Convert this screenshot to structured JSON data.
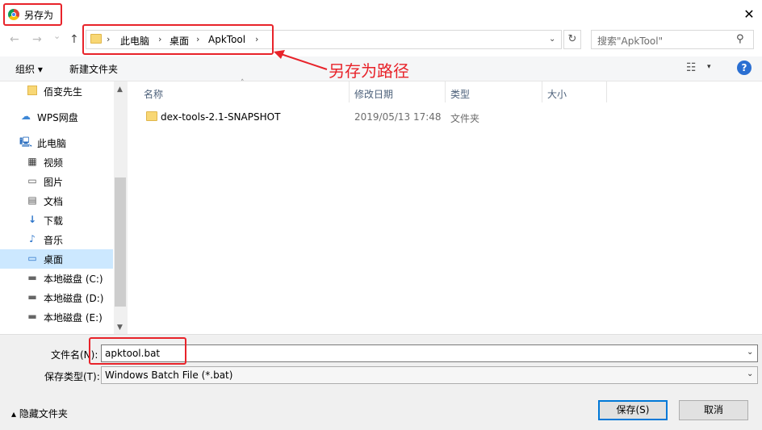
{
  "window": {
    "title": "另存为",
    "close_glyph": "✕"
  },
  "nav": {
    "back_glyph": "←",
    "forward_glyph": "→",
    "recent_glyph": "⌄",
    "up_glyph": "↑",
    "breadcrumb": [
      {
        "label": "此电脑"
      },
      {
        "label": "桌面"
      },
      {
        "label": "ApkTool"
      }
    ],
    "sep_glyph": "›",
    "dropdown_glyph": "⌄",
    "refresh_glyph": "↻",
    "search_placeholder": "搜索\"ApkTool\"",
    "search_glyph": "⚲"
  },
  "toolbar": {
    "organize_label": "组织 ▾",
    "new_folder_label": "新建文件夹",
    "view_glyph": "☷",
    "view_dd_glyph": "▾",
    "help_glyph": "?"
  },
  "sidebar": {
    "items": [
      {
        "label": "佰变先生",
        "icon": "folder-icon",
        "glyph": ""
      },
      {
        "label": "WPS网盘",
        "icon": "cloud-icon",
        "glyph": "☁"
      },
      {
        "label": "此电脑",
        "icon": "computer-icon",
        "glyph": "🖳"
      },
      {
        "label": "视频",
        "icon": "video-icon",
        "glyph": "▦"
      },
      {
        "label": "图片",
        "icon": "picture-icon",
        "glyph": "▭"
      },
      {
        "label": "文档",
        "icon": "document-icon",
        "glyph": "▤"
      },
      {
        "label": "下载",
        "icon": "download-icon",
        "glyph": "↓"
      },
      {
        "label": "音乐",
        "icon": "music-icon",
        "glyph": "♪"
      },
      {
        "label": "桌面",
        "icon": "desktop-icon",
        "glyph": "▭"
      },
      {
        "label": "本地磁盘 (C:)",
        "icon": "drive-icon",
        "glyph": "▬"
      },
      {
        "label": "本地磁盘 (D:)",
        "icon": "drive-icon",
        "glyph": "▬"
      },
      {
        "label": "本地磁盘 (E:)",
        "icon": "drive-icon",
        "glyph": "▬"
      }
    ],
    "selected": "桌面",
    "scroll_up_glyph": "▲",
    "scroll_down_glyph": "▼"
  },
  "file_list": {
    "columns": [
      "名称",
      "修改日期",
      "类型",
      "大小"
    ],
    "sort_glyph": "˄",
    "rows": [
      {
        "name": "dex-tools-2.1-SNAPSHOT",
        "modified": "2019/05/13 17:48",
        "type": "文件夹",
        "size": ""
      }
    ]
  },
  "form": {
    "filename_label": "文件名(N):",
    "filename_value": "apktool.bat",
    "filetype_label": "保存类型(T):",
    "filetype_value": "Windows Batch File (*.bat)",
    "dropdown_glyph": "⌄"
  },
  "footer": {
    "hide_folders_label": "▴  隐藏文件夹",
    "save_label": "保存(S)",
    "cancel_label": "取消"
  },
  "annotation": {
    "text": "另存为路径",
    "color": "#e8232a"
  }
}
